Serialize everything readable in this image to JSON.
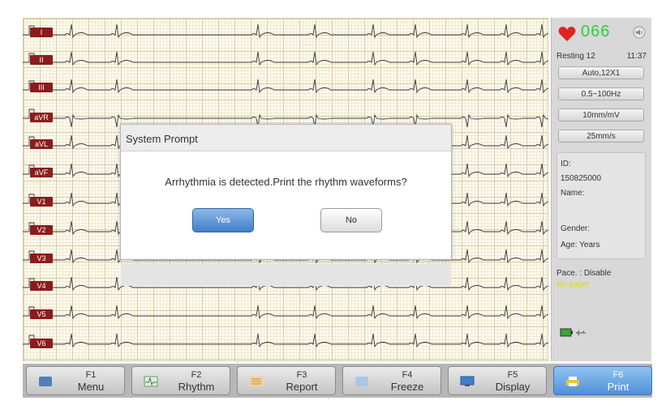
{
  "leads": [
    "I",
    "II",
    "III",
    "aVR",
    "aVL",
    "aVF",
    "V1",
    "V2",
    "V3",
    "V4",
    "V5",
    "V6"
  ],
  "status": {
    "heart_rate": "066",
    "mode": "Resting 12",
    "clock": "11:37"
  },
  "settings": [
    "Auto,12X1",
    "0.5~100Hz",
    "10mm/mV",
    "25mm/s"
  ],
  "patient": {
    "id_label": "ID:",
    "id_value": "150825000",
    "name_label": "Name:",
    "gender_label": "Gender:",
    "age_label": "Age:  Years"
  },
  "pace": "Pace. : Disable",
  "paper_status": "No paper",
  "toolbar": [
    {
      "key": "F1",
      "label": "Menu"
    },
    {
      "key": "F2",
      "label": "Rhythm"
    },
    {
      "key": "F3",
      "label": "Report"
    },
    {
      "key": "F4",
      "label": "Freeze"
    },
    {
      "key": "F5",
      "label": "Display"
    },
    {
      "key": "F6",
      "label": "Print"
    }
  ],
  "dialog": {
    "title": "System Prompt",
    "message": "Arrhythmia is detected.Print the rhythm waveforms?",
    "yes_label": "Yes",
    "no_label": "No"
  },
  "colors": {
    "lead_label_bg": "#8c1c1c",
    "heart_rate": "#2ecc40",
    "paper_warning": "#e6d800",
    "active_button": "#4f90d8"
  }
}
